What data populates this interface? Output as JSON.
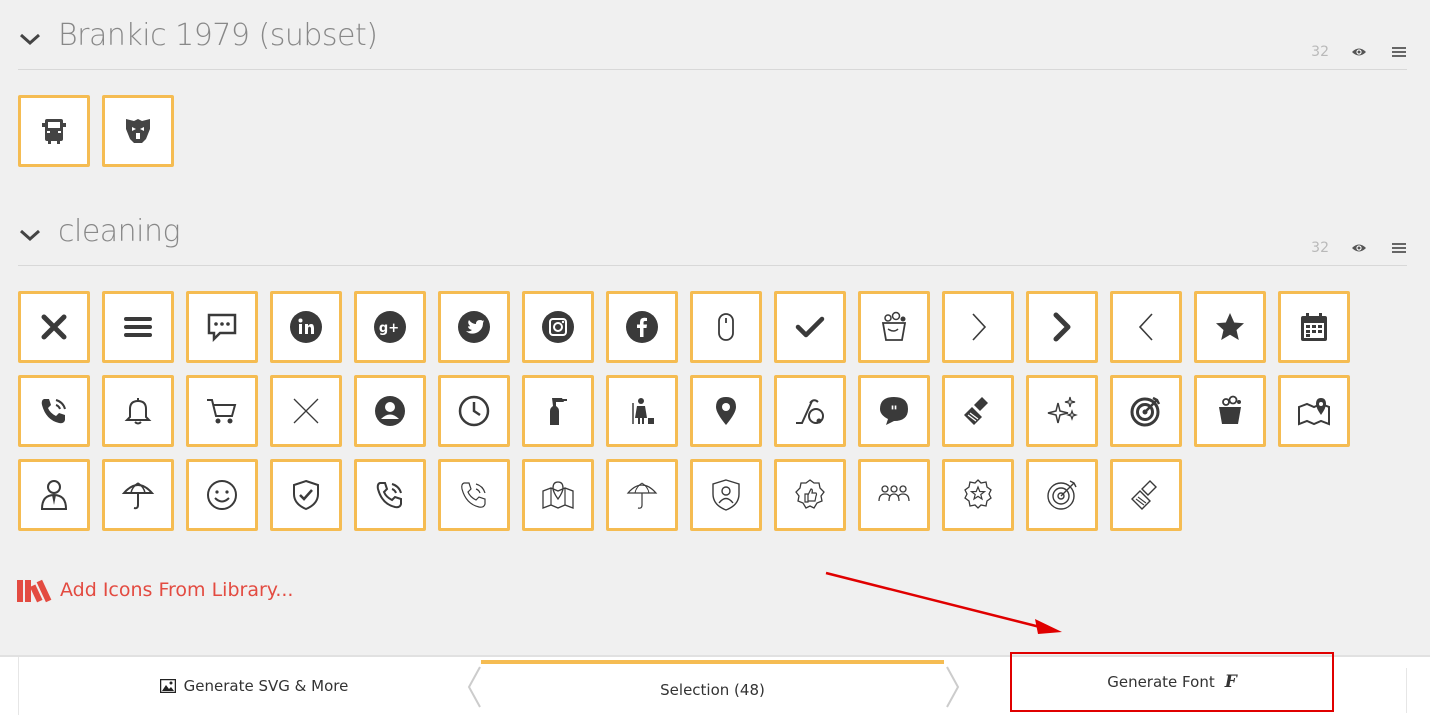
{
  "sets": [
    {
      "title": "Brankic 1979 (subset)",
      "size": "32",
      "rows": [
        [
          "truck-icon",
          "transformers-icon"
        ]
      ]
    },
    {
      "title": "cleaning",
      "size": "32",
      "rows": [
        [
          "close-x-icon",
          "menu-icon",
          "chat-icon",
          "linkedin-icon",
          "google-plus-icon",
          "twitter-icon",
          "instagram-icon",
          "facebook-icon",
          "mouse-icon",
          "check-icon",
          "bucket-icon",
          "chevron-right-thin-icon",
          "chevron-right-bold-icon",
          "chevron-left-thin-icon",
          "star-icon",
          "calendar-icon"
        ],
        [
          "phone-ringing-icon",
          "bell-icon",
          "cart-icon",
          "close-thin-icon",
          "user-circle-icon",
          "clock-icon",
          "spray-bottle-icon",
          "cleaning-lady-icon",
          "map-pin-icon",
          "vacuum-icon",
          "quote-bubble-icon",
          "brush-icon",
          "sparkles-icon",
          "target-icon",
          "wash-bucket-icon",
          "map-location-icon"
        ],
        [
          "worker-icon",
          "umbrella-icon",
          "smile-icon",
          "shield-check-icon",
          "phone-outline-icon",
          "phone-thin-icon",
          "map-outline-icon",
          "umbrella-thin-icon",
          "shield-user-icon",
          "badge-thumb-icon",
          "team-icon",
          "badge-star-icon",
          "target-thin-icon",
          "brush-outline-icon"
        ]
      ]
    }
  ],
  "add_library": {
    "label": "Add Icons From Library..."
  },
  "bottom_bar": {
    "svg_label": "Generate SVG & More",
    "selection_label": "Selection (48)",
    "font_label": "Generate Font",
    "font_glyph": "F"
  },
  "colors": {
    "tile_border": "#f5bc52",
    "accent_red": "#e34b41",
    "highlight_box": "#e00000"
  }
}
